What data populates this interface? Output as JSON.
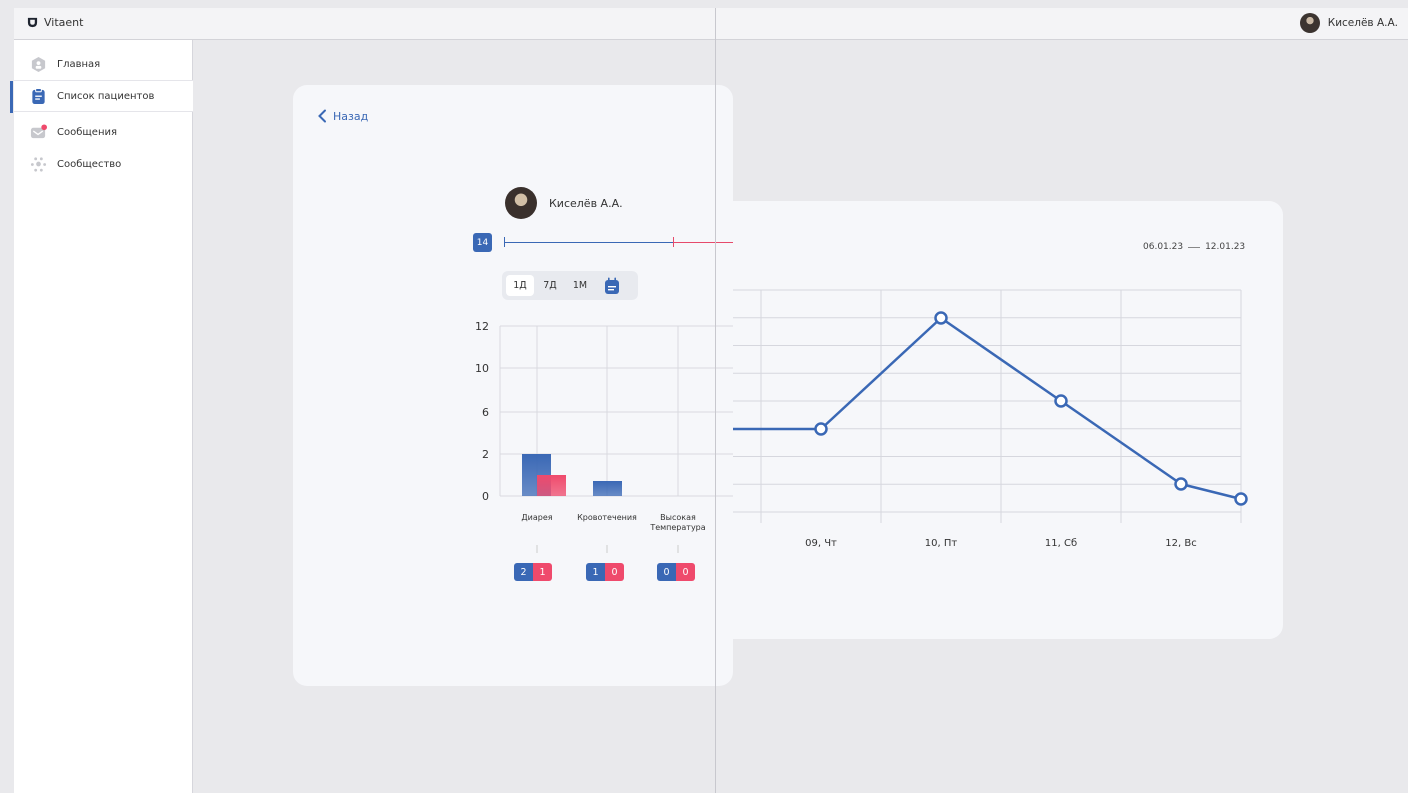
{
  "app": {
    "name": "Vitaent"
  },
  "user": {
    "name": "Киселёв А.А."
  },
  "sidebar": {
    "items": [
      {
        "label": "Главная",
        "icon": "home-icon"
      },
      {
        "label": "Список пациентов",
        "icon": "clipboard-icon"
      },
      {
        "label": "Сообщения",
        "icon": "mail-icon"
      },
      {
        "label": "Сообщество",
        "icon": "community-icon"
      }
    ]
  },
  "patient_card": {
    "back_label": "Назад",
    "patient_name": "Киселёв А.А.",
    "day_badge": "14",
    "segments": [
      "1Д",
      "7Д",
      "1М"
    ],
    "active_segment": "1Д"
  },
  "chart_data": [
    {
      "type": "bar",
      "categories": [
        "Диарея",
        "Кровотечения",
        "Высокая\nТемпература"
      ],
      "y_ticks": [
        "0",
        "2",
        "6",
        "10",
        "12"
      ],
      "series": [
        {
          "color": "#3a68b5",
          "values": [
            2,
            1,
            0
          ]
        },
        {
          "color": "#ef4a6c",
          "values": [
            1,
            0,
            0
          ]
        }
      ]
    },
    {
      "type": "line",
      "categories": [
        "09, Чт",
        "10, Пт",
        "11, Сб",
        "12, Вс"
      ],
      "date_from": "06.01.23",
      "date_to": "12.01.23",
      "color": "#3a68b5"
    }
  ],
  "colors": {
    "accent": "#3a68b5",
    "alert": "#ef4a6c"
  }
}
